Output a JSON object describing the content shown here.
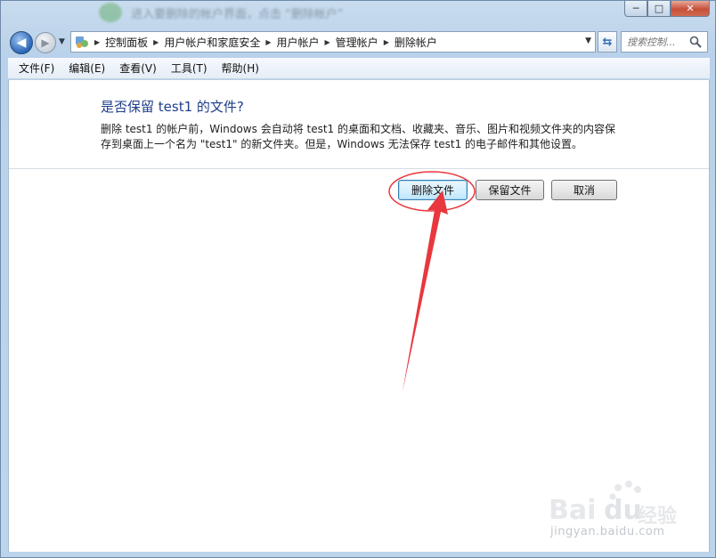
{
  "window": {
    "title_blurred": "进入要删除的帐户界面，点击 “删除帐户”",
    "caption": {
      "minimize": "─",
      "maximize": "□",
      "close": "✕"
    }
  },
  "address": {
    "crumbs": [
      "控制面板",
      "用户帐户和家庭安全",
      "用户帐户",
      "管理帐户",
      "删除帐户"
    ]
  },
  "search": {
    "placeholder": "搜索控制..."
  },
  "menu": [
    "文件(F)",
    "编辑(E)",
    "查看(V)",
    "工具(T)",
    "帮助(H)"
  ],
  "dialog": {
    "heading": "是否保留 test1 的文件?",
    "line1": "删除 test1 的帐户前，Windows 会自动将 test1 的桌面和文档、收藏夹、音乐、图片和视频文件夹的内容保",
    "line2": "存到桌面上一个名为 \"test1\" 的新文件夹。但是，Windows 无法保存 test1 的电子邮件和其他设置。",
    "buttons": {
      "delete_files": "删除文件",
      "keep_files": "保留文件",
      "cancel": "取消"
    }
  },
  "watermark": {
    "brand": "Bai",
    "brand2": "du",
    "product": "经验",
    "url": "jingyan.baidu.com"
  },
  "colors": {
    "heading": "#1e3f8a",
    "annotation": "#e8383d"
  }
}
